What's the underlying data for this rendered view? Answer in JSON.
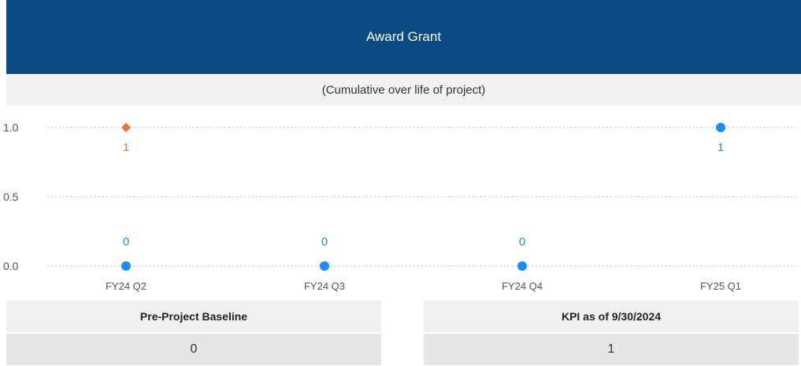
{
  "header": {
    "title": "Award Grant"
  },
  "subheader": {
    "text": "(Cumulative over life of project)"
  },
  "chart_data": {
    "type": "scatter",
    "categories": [
      "FY24 Q2",
      "FY24 Q3",
      "FY24 Q4",
      "FY25 Q1"
    ],
    "yticks": [
      "0.0",
      "0.5",
      "1.0"
    ],
    "ylim": [
      0,
      1
    ],
    "grid": true,
    "series": [
      {
        "marker": "circle",
        "color": "#1a8cff",
        "points": [
          {
            "x": "FY24 Q2",
            "y": 0,
            "label": "0"
          },
          {
            "x": "FY24 Q3",
            "y": 0,
            "label": "0"
          },
          {
            "x": "FY24 Q4",
            "y": 0,
            "label": "0"
          },
          {
            "x": "FY25 Q1",
            "y": 1,
            "label": "1"
          }
        ]
      },
      {
        "marker": "diamond",
        "color": "#e8723a",
        "points": [
          {
            "x": "FY24 Q2",
            "y": 1,
            "label": "1"
          }
        ]
      }
    ]
  },
  "cards": {
    "baseline": {
      "label": "Pre-Project Baseline",
      "value": "0"
    },
    "kpi": {
      "label": "KPI as of 9/30/2024",
      "value": "1"
    }
  }
}
